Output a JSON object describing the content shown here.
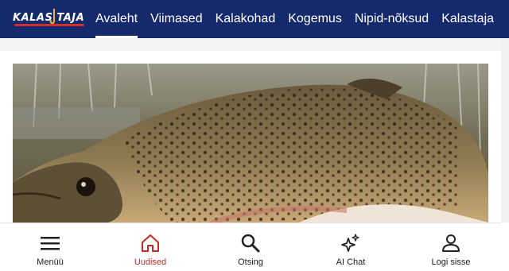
{
  "header": {
    "logo_text": "KALAS TAJA",
    "nav": [
      {
        "label": "Avaleht",
        "active": true
      },
      {
        "label": "Viimased",
        "active": false
      },
      {
        "label": "Kalakohad",
        "active": false
      },
      {
        "label": "Kogemus",
        "active": false
      },
      {
        "label": "Nipid-nõksud",
        "active": false
      },
      {
        "label": "Kalastaja",
        "active": false
      }
    ]
  },
  "colors": {
    "header_bg": "#152a6c",
    "accent_red": "#c62828",
    "text_dark": "#222222"
  },
  "bottom_nav": [
    {
      "label": "Menüü",
      "icon": "menu-icon",
      "active": false
    },
    {
      "label": "Uudised",
      "icon": "home-icon",
      "active": true
    },
    {
      "label": "Otsing",
      "icon": "search-icon",
      "active": false
    },
    {
      "label": "AI Chat",
      "icon": "sparkles-icon",
      "active": false
    },
    {
      "label": "Logi sisse",
      "icon": "user-icon",
      "active": false
    }
  ]
}
